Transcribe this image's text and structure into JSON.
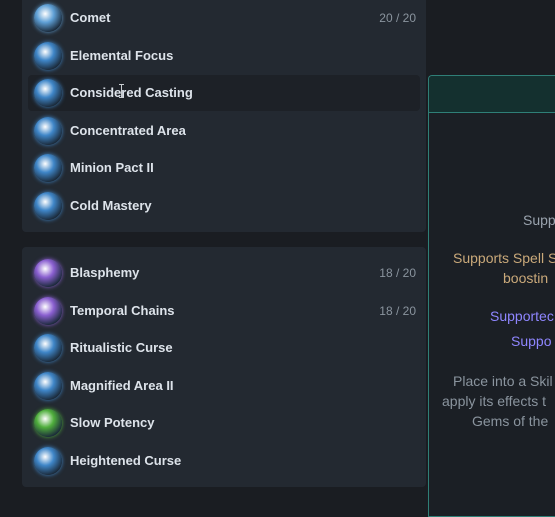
{
  "groups": [
    {
      "items": [
        {
          "name": "Comet",
          "level": "20 / 20",
          "icon": "comet-gem-icon",
          "color": "#5fa0d6"
        },
        {
          "name": "Elemental Focus",
          "level": "",
          "icon": "elemental-focus-gem-icon",
          "color": "#3f86c8"
        },
        {
          "name": "Considered Casting",
          "level": "",
          "icon": "considered-casting-gem-icon",
          "color": "#3f86c8"
        },
        {
          "name": "Concentrated Area",
          "level": "",
          "icon": "concentrated-area-gem-icon",
          "color": "#3f86c8"
        },
        {
          "name": "Minion Pact II",
          "level": "",
          "icon": "minion-pact-gem-icon",
          "color": "#3f86c8"
        },
        {
          "name": "Cold Mastery",
          "level": "",
          "icon": "cold-mastery-gem-icon",
          "color": "#3f86c8"
        }
      ]
    },
    {
      "items": [
        {
          "name": "Blasphemy",
          "level": "18 / 20",
          "icon": "blasphemy-gem-icon",
          "color": "#8a5fd0"
        },
        {
          "name": "Temporal Chains",
          "level": "18 / 20",
          "icon": "temporal-chains-gem-icon",
          "color": "#8a5fd0"
        },
        {
          "name": "Ritualistic Curse",
          "level": "",
          "icon": "ritualistic-curse-gem-icon",
          "color": "#3f86c8"
        },
        {
          "name": "Magnified Area II",
          "level": "",
          "icon": "magnified-area-gem-icon",
          "color": "#3f86c8"
        },
        {
          "name": "Slow Potency",
          "level": "",
          "icon": "slow-potency-gem-icon",
          "color": "#4fae3c"
        },
        {
          "name": "Heightened Curse",
          "level": "",
          "icon": "heightened-curse-gem-icon",
          "color": "#3f86c8"
        }
      ]
    }
  ],
  "hovered": "Considered Casting",
  "tooltip": {
    "accent": "C",
    "line1": "Supp",
    "line2": "Supports Spell S",
    "line3": "boostin",
    "line4": "Supportec",
    "line5": "Suppo",
    "line6": "Place into a Skil",
    "line7": "apply its effects t",
    "line8": "Gems of the"
  }
}
